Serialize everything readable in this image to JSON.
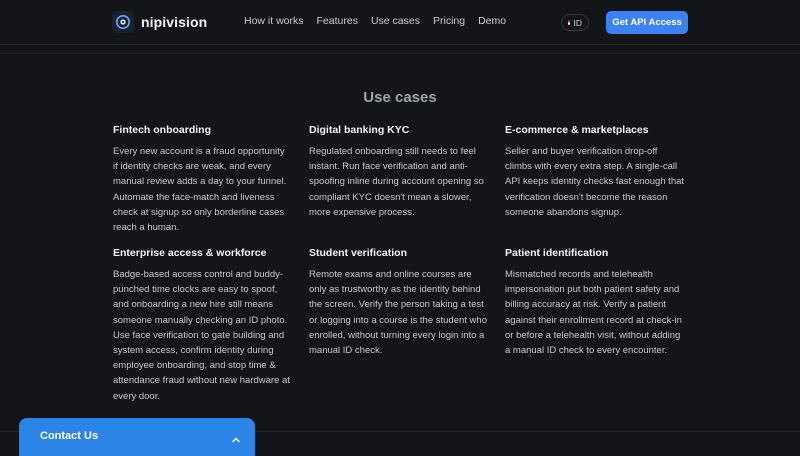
{
  "header": {
    "brand": "nipivision",
    "nav": [
      "How it works",
      "Features",
      "Use cases",
      "Pricing",
      "Demo"
    ],
    "language": "ID",
    "cta_label": "Get API Access"
  },
  "section": {
    "title": "Use cases",
    "cards": [
      {
        "title": "Fintech onboarding",
        "text": "Every new account is a fraud opportunity if identity checks are weak, and every manual review adds a day to your funnel. Automate the face-match and liveness check at signup so only borderline cases reach a human."
      },
      {
        "title": "Digital banking KYC",
        "text": "Regulated onboarding still needs to feel instant. Run face verification and anti-spoofing inline during account opening so compliant KYC doesn't mean a slower, more expensive process."
      },
      {
        "title": "E-commerce & marketplaces",
        "text": "Seller and buyer verification drop-off climbs with every extra step. A single-call API keeps identity checks fast enough that verification doesn't become the reason someone abandons signup."
      },
      {
        "title": "Enterprise access & workforce",
        "text": "Badge-based access control and buddy-punched time clocks are easy to spoof, and onboarding a new hire still means someone manually checking an ID photo. Use face verification to gate building and system access, confirm identity during employee onboarding, and stop time & attendance fraud without new hardware at every door."
      },
      {
        "title": "Student verification",
        "text": "Remote exams and online courses are only as trustworthy as the identity behind the screen. Verify the person taking a test or logging into a course is the student who enrolled, without turning every login into a manual ID check."
      },
      {
        "title": "Patient identification",
        "text": "Mismatched records and telehealth impersonation put both patient safety and billing accuracy at risk. Verify a patient against their enrollment record at check-in or before a telehealth visit, without adding a manual ID check to every encounter."
      }
    ]
  },
  "contact": {
    "label": "Contact Us"
  },
  "colors": {
    "background": "#141518",
    "accent": "#3b82f6",
    "contact": "#2b84e8"
  },
  "icons": {
    "logo": "aperture-logo-icon",
    "flag": "indonesia-flag-icon",
    "chevron": "chevron-up-icon"
  }
}
